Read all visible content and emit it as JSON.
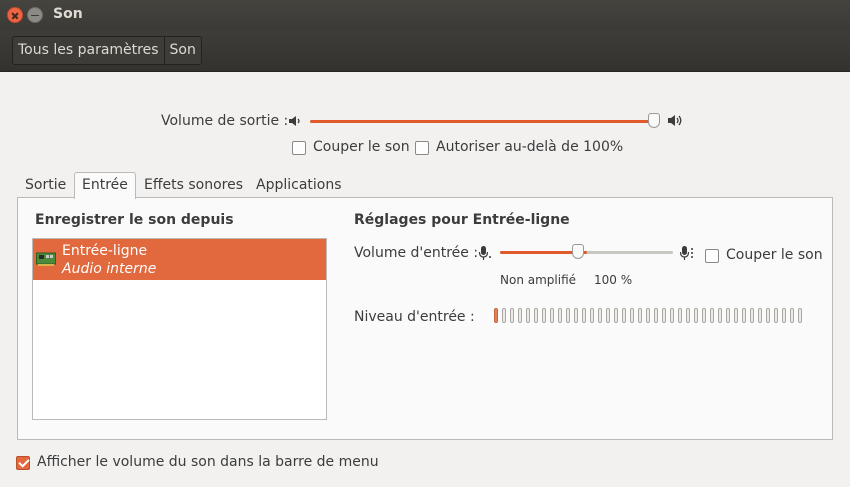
{
  "window": {
    "title": "Son"
  },
  "breadcrumb": {
    "all_settings": "Tous les paramètres",
    "current": "Son"
  },
  "output": {
    "volume_label": "Volume de sortie :",
    "volume_level": 0.99,
    "mute_label": "Couper le son",
    "mute_checked": false,
    "overamplify_label": "Autoriser au-delà de 100%",
    "overamplify_checked": false
  },
  "tabs": [
    {
      "label": "Sortie",
      "active": false
    },
    {
      "label": "Entrée",
      "active": true
    },
    {
      "label": "Effets sonores",
      "active": false
    },
    {
      "label": "Applications",
      "active": false
    }
  ],
  "input": {
    "record_from_heading": "Enregistrer le son depuis",
    "devices": [
      {
        "name": "Entrée-ligne",
        "description": "Audio interne",
        "selected": true
      }
    ],
    "settings_heading": "Réglages pour Entrée-ligne",
    "volume_label": "Volume d'entrée :",
    "volume_level": 0.5,
    "mark_unamplified": "Non amplifié",
    "mark_100": "100 %",
    "mute_label": "Couper le son",
    "mute_checked": false,
    "level_label": "Niveau d'entrée :",
    "level_bars_total": 39,
    "level_bars_active": 1
  },
  "footer": {
    "show_volume_label": "Afficher le volume du son dans la barre de menu",
    "show_volume_checked": true
  },
  "colors": {
    "accent": "#e2683d",
    "titlebar": "#3b3a36"
  },
  "icons": [
    "close-icon",
    "minimize-icon",
    "speaker-low-icon",
    "speaker-high-icon",
    "microphone-low-icon",
    "microphone-high-icon",
    "sound-card-icon"
  ]
}
